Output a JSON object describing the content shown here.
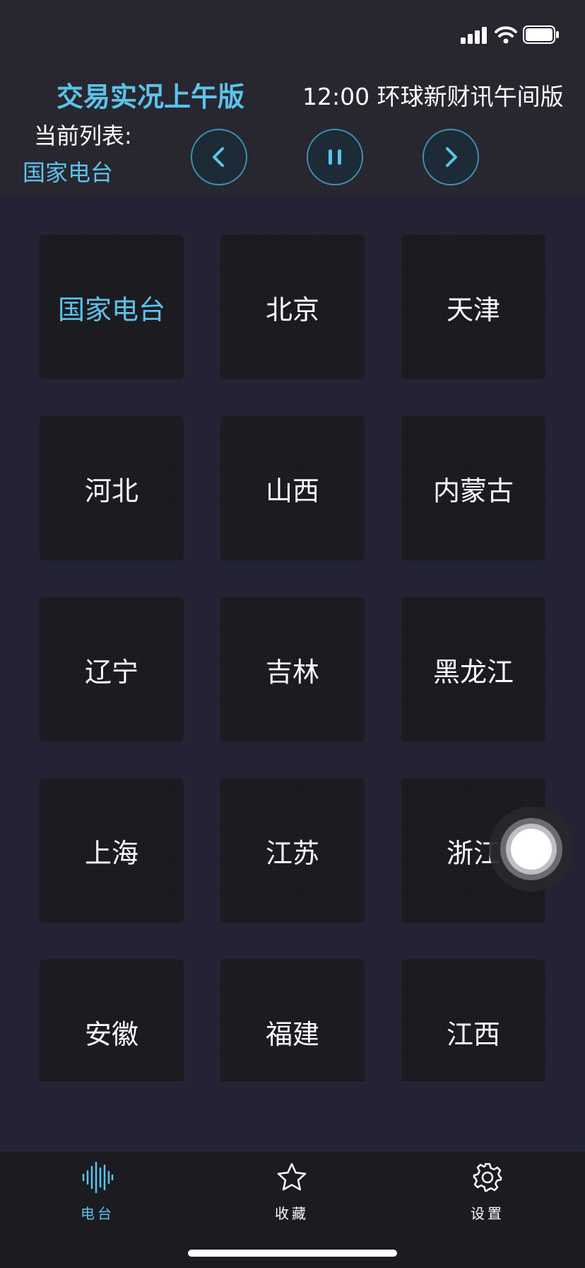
{
  "colors": {
    "accent": "#5bc3ec",
    "background": "#232335",
    "tile": "#17161c"
  },
  "status_bar": {
    "icons": [
      "signal-icon",
      "wifi-icon",
      "battery-icon"
    ]
  },
  "header": {
    "program_title": "交易实况上午版",
    "next_program": "12:00  环球新财讯午间版",
    "current_list_label": "当前列表:",
    "current_list_value": "国家电台"
  },
  "controls": {
    "icons": [
      "chevron-left-icon",
      "pause-icon",
      "chevron-right-icon"
    ]
  },
  "stations": [
    {
      "label": "国家电台",
      "active": true
    },
    {
      "label": "北京"
    },
    {
      "label": "天津"
    },
    {
      "label": "河北"
    },
    {
      "label": "山西"
    },
    {
      "label": "内蒙古"
    },
    {
      "label": "辽宁"
    },
    {
      "label": "吉林"
    },
    {
      "label": "黑龙江"
    },
    {
      "label": "上海"
    },
    {
      "label": "江苏"
    },
    {
      "label": "浙江"
    },
    {
      "label": "安徽"
    },
    {
      "label": "福建"
    },
    {
      "label": "江西"
    }
  ],
  "tabbar": {
    "tabs": [
      {
        "label": "电台",
        "icon": "waveform-icon",
        "active": true
      },
      {
        "label": "收藏",
        "icon": "star-icon"
      },
      {
        "label": "设置",
        "icon": "gear-icon"
      }
    ]
  }
}
